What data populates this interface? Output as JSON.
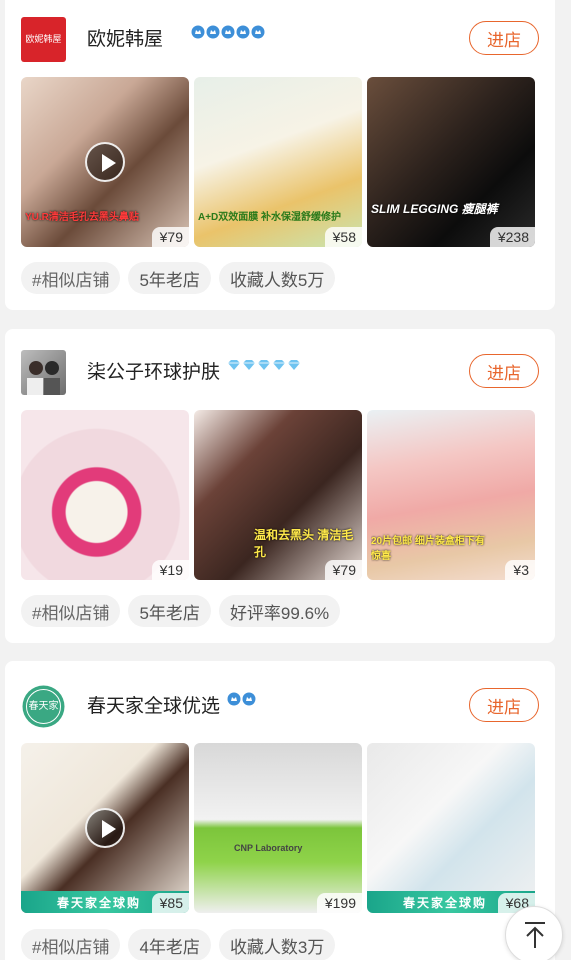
{
  "shops": [
    {
      "logo_text": "欧妮韩屋",
      "logo_color": "#d8242a",
      "name": "欧妮韩屋",
      "rank_icon": "blue-crown-icon",
      "rank_count": 5,
      "enter_label": "进店",
      "products": [
        {
          "price": "¥79",
          "has_video": true,
          "caption": "YU.R清洁毛孔去黑头鼻贴"
        },
        {
          "price": "¥58",
          "has_video": false,
          "caption": "A+D双效面膜 补水保湿舒缓修护"
        },
        {
          "price": "¥238",
          "has_video": false,
          "caption": "SLIM LEGGING 瘦腿裤"
        }
      ],
      "tags": [
        {
          "label": "#相似店铺",
          "link": true
        },
        {
          "label": "5年老店",
          "link": false
        },
        {
          "label": "收藏人数5万",
          "link": false
        }
      ]
    },
    {
      "logo_text": "",
      "logo_color": "#8a8a8a",
      "name": "柒公子环球护肤",
      "rank_icon": "diamond-icon",
      "rank_count": 5,
      "enter_label": "进店",
      "products": [
        {
          "price": "¥19",
          "has_video": false,
          "caption": ""
        },
        {
          "price": "¥79",
          "has_video": false,
          "caption": "温和去黑头 清洁毛孔"
        },
        {
          "price": "¥3",
          "has_video": false,
          "caption": "20片包邮 细片装盒柜下有惊喜"
        }
      ],
      "tags": [
        {
          "label": "#相似店铺",
          "link": true
        },
        {
          "label": "5年老店",
          "link": false
        },
        {
          "label": "好评率99.6%",
          "link": false
        }
      ]
    },
    {
      "logo_text": "春天家",
      "logo_color": "#ffffff",
      "name": "春天家全球优选",
      "rank_icon": "blue-crown-icon",
      "rank_count": 2,
      "enter_label": "进店",
      "products": [
        {
          "price": "¥85",
          "has_video": true,
          "caption": "春天家全球购",
          "banner": "春天家全球购"
        },
        {
          "price": "¥199",
          "has_video": false,
          "caption": "CNP Laboratory"
        },
        {
          "price": "¥68",
          "has_video": false,
          "caption": "春天家全球购",
          "banner": "春天家全球购"
        }
      ],
      "tags": [
        {
          "label": "#相似店铺",
          "link": true
        },
        {
          "label": "4年老店",
          "link": false
        },
        {
          "label": "收藏人数3万",
          "link": false
        }
      ]
    }
  ],
  "back_to_top": "back-to-top"
}
